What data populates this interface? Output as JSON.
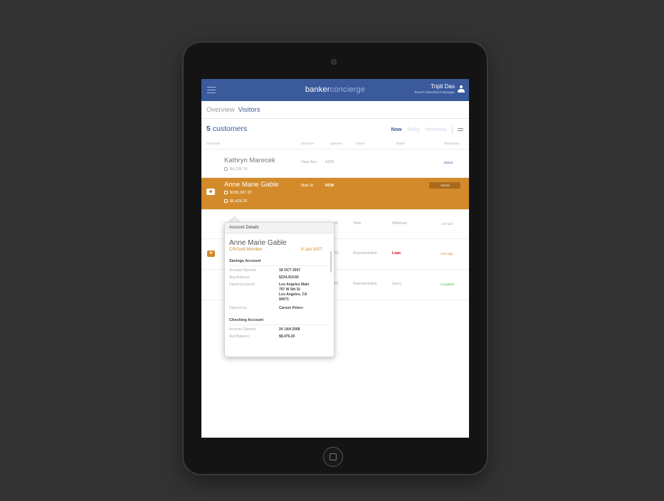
{
  "app": {
    "logo_bold": "banker",
    "logo_light": "concierge",
    "user_name": "Tripti Das",
    "user_role": "Branch Operations Manager"
  },
  "tabs": {
    "overview": "Overview",
    "visitors": "Visitors"
  },
  "summary": {
    "count": "5",
    "count_label": "customers"
  },
  "filters": {
    "now": "Now",
    "today": "Today",
    "yesterday": "Yesterday"
  },
  "columns": {
    "customer": "Customer",
    "entrance": "Entrance",
    "queued": "Queued",
    "action": "Action",
    "detail": "Detail",
    "response": "Response"
  },
  "rows": [
    {
      "name": "Kathryn Marecek",
      "amount": "$4,238.78",
      "entrance": "Hope Ave.",
      "queued": "NOW",
      "response": "Attend",
      "response_color": "#3a5a9c"
    },
    {
      "name": "Anne Marie Gable",
      "amount_1": "$238,187.32",
      "amount_2": "$6,426.20",
      "entrance": "Main St",
      "queued": "NOW",
      "response": "Attend"
    },
    {
      "queued": ":08",
      "action": "Teller",
      "detail": "Withdraw",
      "response": "on hold",
      "response_color": "#9aa8c6"
    },
    {
      "queued": ":09",
      "action": "Representative",
      "detail": "Loan",
      "detail_color": "#d0021b",
      "response": "Anh Ngy",
      "response_color": "#d38a2a"
    },
    {
      "queued": ":26",
      "action": "Representative",
      "detail": "Query",
      "response": "Complete",
      "response_color": "#4caf50"
    }
  ],
  "popover": {
    "header": "Account Details",
    "name": "Anne Marie Gable",
    "member_level": "CR/Gold Member",
    "member_since": "4 Jan 2007",
    "savings": {
      "title": "Savings Account",
      "opened_label": "Account Opened:",
      "opened_value": "18 OCT 2007",
      "balance_label": "Avg Balance:",
      "balance_value": "$234,419.60",
      "branch_label": "Opening branch:",
      "branch_value": "Los Angeles Main\n707 W 5th St\nLos Angeles, CA\n90071",
      "opened_by_label": "Opened by:",
      "opened_by_value": "Carson Peters"
    },
    "checking": {
      "title": "Checking Account",
      "opened_label": "Account Opened:",
      "opened_value": "24 JAN 2008",
      "balance_label": "Avg Balance:",
      "balance_value": "$8,476.20"
    }
  }
}
